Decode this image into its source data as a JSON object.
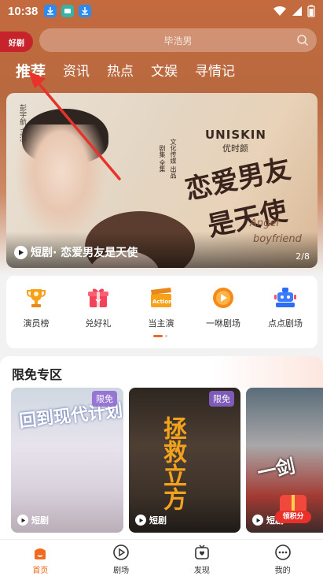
{
  "status_bar": {
    "time": "10:38"
  },
  "header": {
    "logo_text": "好剧",
    "search_placeholder": "毕浩男",
    "tabs": [
      {
        "label": "推荐",
        "active": true
      },
      {
        "label": "资讯",
        "active": false
      },
      {
        "label": "热点",
        "active": false
      },
      {
        "label": "文娱",
        "active": false
      },
      {
        "label": "寻情记",
        "active": false
      }
    ]
  },
  "banner": {
    "caption_prefix": "短剧",
    "caption_title": "· 恋爱男友是天使",
    "counter": "2/8",
    "brand_en": "UNISKIN",
    "brand_cn": "优时颜",
    "art_line1": "恋爱男友",
    "art_line2": "是天使",
    "art_en_1": "Angel",
    "art_en_2": "boyfriend",
    "vertical_text_1": "彭宇航 主演",
    "vertical_text_2": "文化传媒 出品",
    "vertical_text_3": "剧集 全集"
  },
  "quick_entries": [
    {
      "label": "演员榜",
      "icon": "trophy-icon"
    },
    {
      "label": "兑好礼",
      "icon": "gift-icon"
    },
    {
      "label": "当主演",
      "icon": "clapperboard-icon"
    },
    {
      "label": "一咻剧场",
      "icon": "play-disc-icon"
    },
    {
      "label": "点点剧场",
      "icon": "robot-icon"
    }
  ],
  "free_zone": {
    "title": "限免专区",
    "cards": [
      {
        "title_art": "回到现代计划",
        "tag": "限免",
        "label": "短剧"
      },
      {
        "title_art": "拯救立方",
        "tag": "限免",
        "label": "短剧"
      },
      {
        "title_art": "一剑",
        "tag": "",
        "label": "短剧"
      }
    ],
    "gift_label": "领积分"
  },
  "bottom_nav": [
    {
      "label": "首页",
      "active": true
    },
    {
      "label": "剧场",
      "active": false
    },
    {
      "label": "发现",
      "active": false
    },
    {
      "label": "我的",
      "active": false
    }
  ],
  "colors": {
    "accent": "#f06a1f",
    "header_bg": "#c46a3f",
    "annotation_arrow": "#e8322a"
  }
}
